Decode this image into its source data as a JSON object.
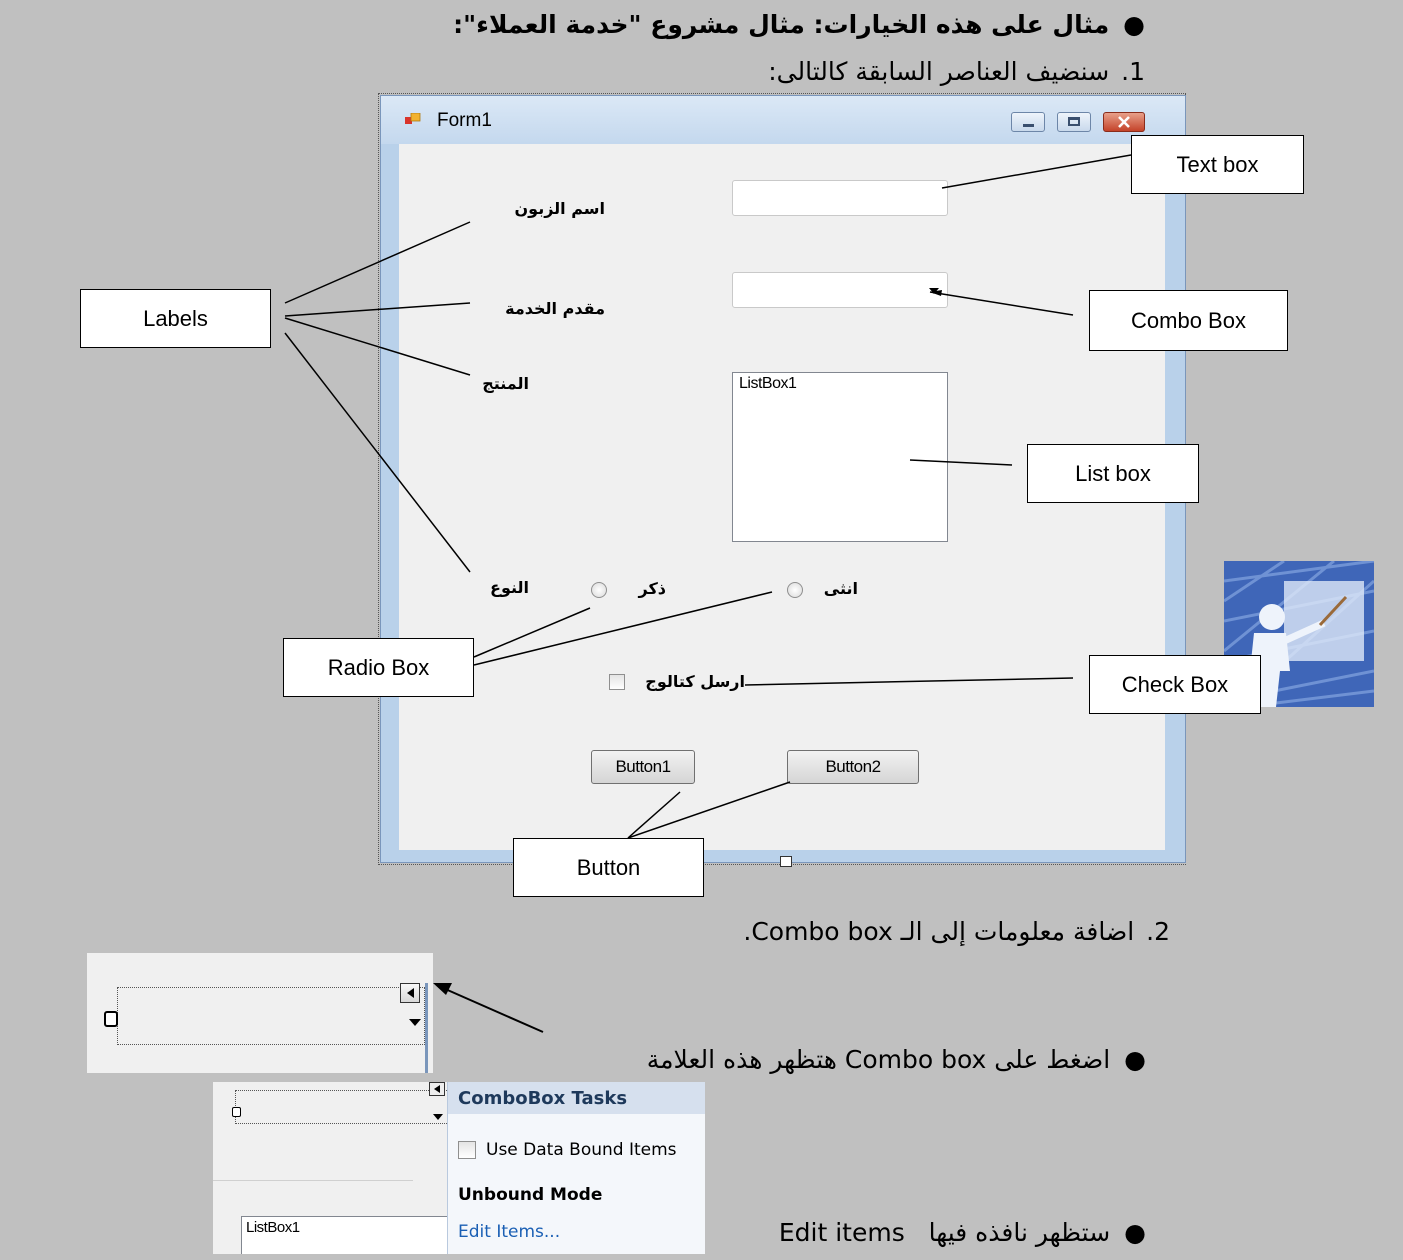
{
  "heading": {
    "bullet_title": "مثال على هذه الخيارات: مثال مشروع \"خدمة العملاء\":",
    "step1_number": "1.",
    "step1_text": "سنضيف العناصر السابقة كالتالى:",
    "step2_number": "2.",
    "step2_text": "اضافة معلومات إلى الـ Combo box."
  },
  "form": {
    "title": "Form1",
    "labels": {
      "customer_name": "اسم الزبون",
      "service_provider": "مقدم الخدمة",
      "product": "المنتج",
      "gender": "النوع"
    },
    "radios": {
      "male": "ذكر",
      "female": "انثى"
    },
    "checkbox_label": "ارسل كتالوج",
    "listbox_text": "ListBox1",
    "button1": "Button1",
    "button2": "Button2"
  },
  "callouts": {
    "text_box": "Text box",
    "combo_box": "Combo Box",
    "labels": "Labels",
    "list_box": "List  box",
    "radio_box": "Radio Box",
    "check_box": "Check Box",
    "button": "Button"
  },
  "instructions": {
    "click_combo": "اضغط على Combo box هتظهر هذه العلامة",
    "edit_items_window": "ستظهر نافذه فيها   Edit items"
  },
  "combo_tasks": {
    "header": "ComboBox Tasks",
    "use_data_bound": "Use Data Bound Items",
    "unbound_mode": "Unbound Mode",
    "edit_items": "Edit Items...",
    "listbox_text": "ListBox1"
  }
}
